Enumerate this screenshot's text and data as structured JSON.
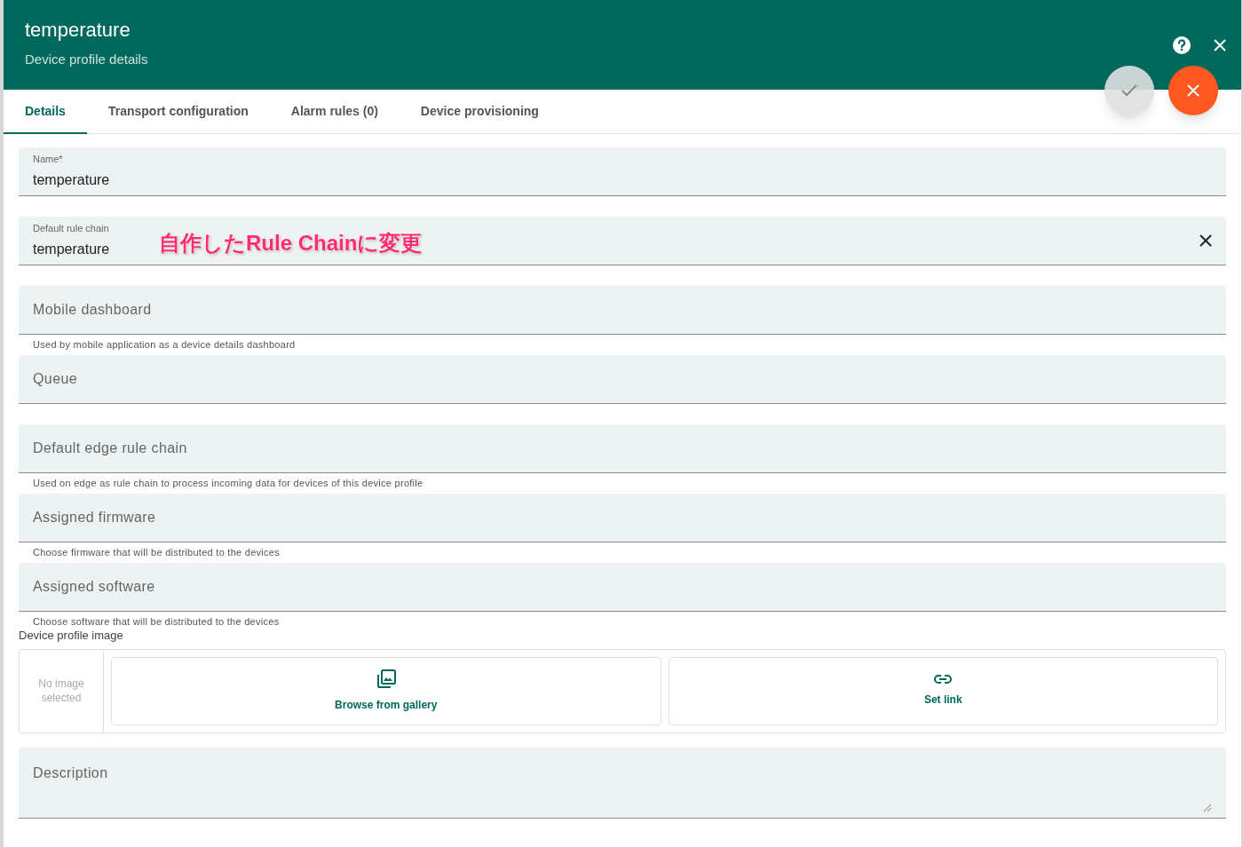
{
  "header": {
    "title": "temperature",
    "subtitle": "Device profile details"
  },
  "actions": [
    {
      "kind": "save",
      "disabled": true
    },
    {
      "kind": "cancel",
      "disabled": false
    }
  ],
  "tabs": [
    {
      "label": "Details",
      "selected": true
    },
    {
      "label": "Transport configuration",
      "selected": false
    },
    {
      "label": "Alarm rules (0)",
      "selected": false
    },
    {
      "label": "Device provisioning",
      "selected": false
    }
  ],
  "fields": [
    {
      "label": "Name*",
      "value": "temperature"
    },
    {
      "label": "Default rule chain",
      "value": "temperature",
      "clearable": true,
      "annotation": "自作したRule Chainに変更"
    },
    {
      "placeholder": "Mobile dashboard",
      "hint": "Used by mobile application as a device details dashboard"
    },
    {
      "placeholder": "Queue"
    },
    {
      "placeholder": "Default edge rule chain",
      "hint": "Used on edge as rule chain to process incoming data for devices of this device profile"
    },
    {
      "placeholder": "Assigned firmware",
      "hint": "Choose firmware that will be distributed to the devices"
    },
    {
      "placeholder": "Assigned software",
      "hint": "Choose software that will be distributed to the devices"
    }
  ],
  "image": {
    "label": "Device profile image",
    "empty_text": "No image selected",
    "buttons": [
      {
        "kind": "gallery",
        "label": "Browse from gallery"
      },
      {
        "kind": "link",
        "label": "Set link"
      }
    ]
  },
  "description": {
    "placeholder": "Description"
  }
}
